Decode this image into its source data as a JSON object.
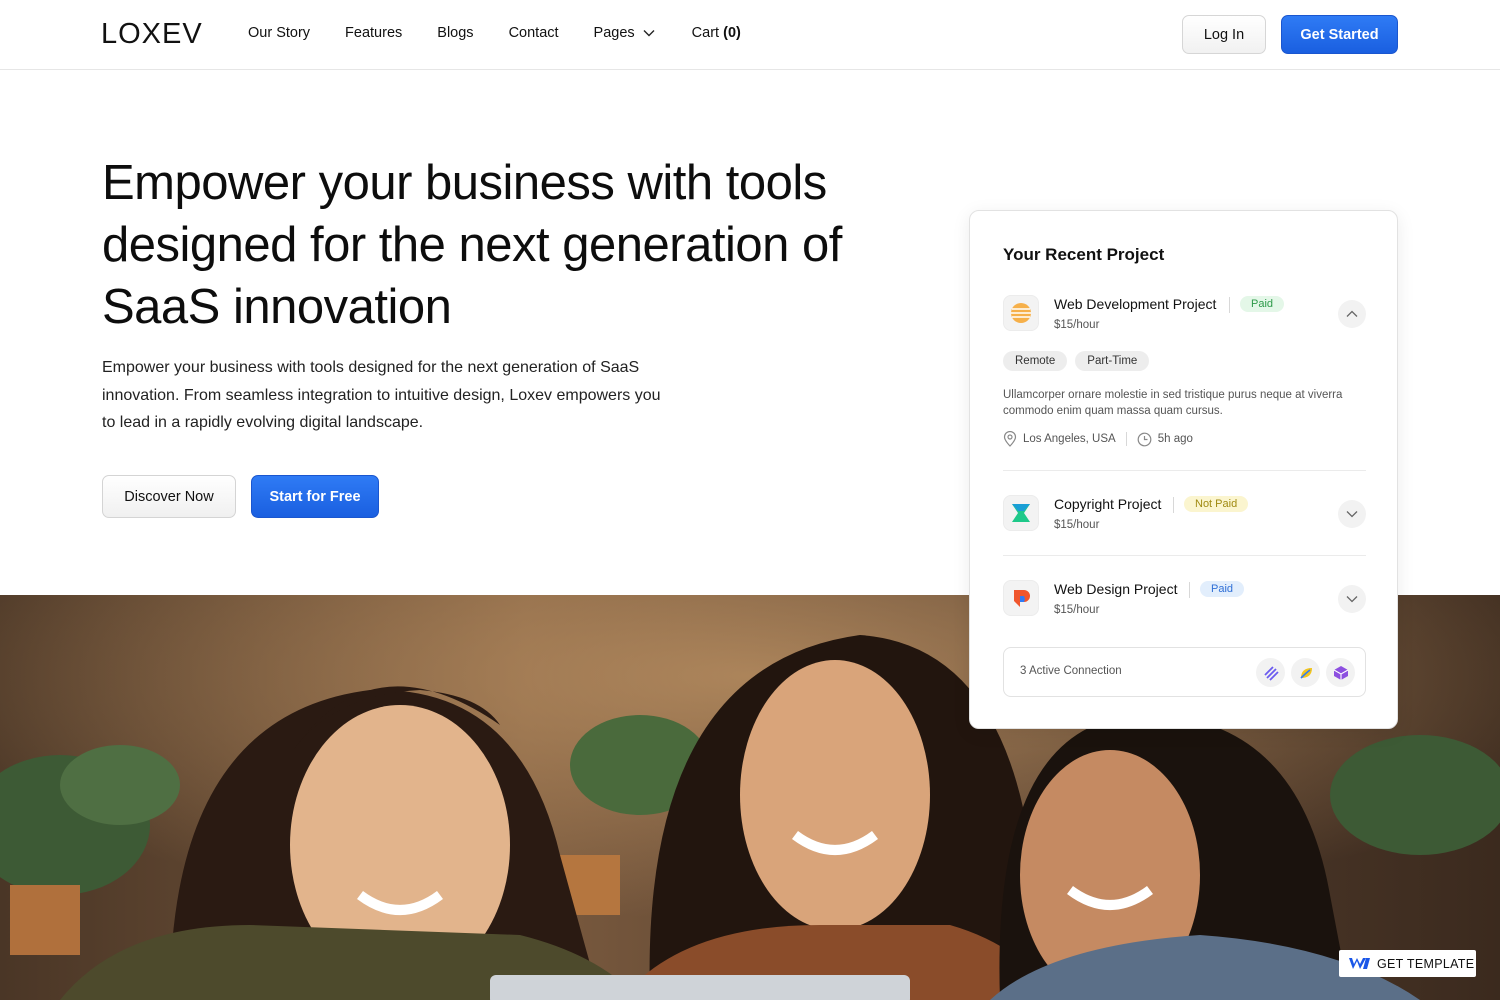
{
  "nav": {
    "logo": "LOXEV",
    "items": [
      {
        "label": "Our Story"
      },
      {
        "label": "Features"
      },
      {
        "label": "Blogs"
      },
      {
        "label": "Contact"
      },
      {
        "label": "Pages"
      }
    ],
    "cart_label": "Cart",
    "cart_count": "(0)",
    "login_label": "Log In",
    "get_started_label": "Get Started"
  },
  "hero": {
    "title": "Empower your business with tools designed for the next generation of SaaS innovation",
    "description": "Empower your business with tools designed for the next generation of SaaS innovation. From seamless integration to intuitive design, Loxev empowers you to lead in a rapidly evolving digital landscape.",
    "discover_label": "Discover Now",
    "free_label": "Start for Free"
  },
  "card": {
    "title": "Your Recent Project",
    "projects": [
      {
        "name": "Web Development Project",
        "status": "Paid",
        "rate": "$15/hour"
      },
      {
        "name": "Copyright Project",
        "status": "Not Paid",
        "rate": "$15/hour"
      },
      {
        "name": "Web Design Project",
        "status": "Paid",
        "rate": "$15/hour"
      }
    ],
    "tags": [
      "Remote",
      "Part-Time"
    ],
    "description": "Ullamcorper ornare molestie in sed tristique purus neque at viverra commodo enim quam massa quam cursus.",
    "location": "Los Angeles, USA",
    "time": "5h ago",
    "connections_label": "3 Active Connection"
  },
  "badge": {
    "label": "GET TEMPLATE"
  },
  "colors": {
    "primary": "#1f66e8",
    "paid_green": "#2e9a4a",
    "not_paid_yellow": "#a08a12",
    "paid_blue": "#2f6fd6"
  }
}
